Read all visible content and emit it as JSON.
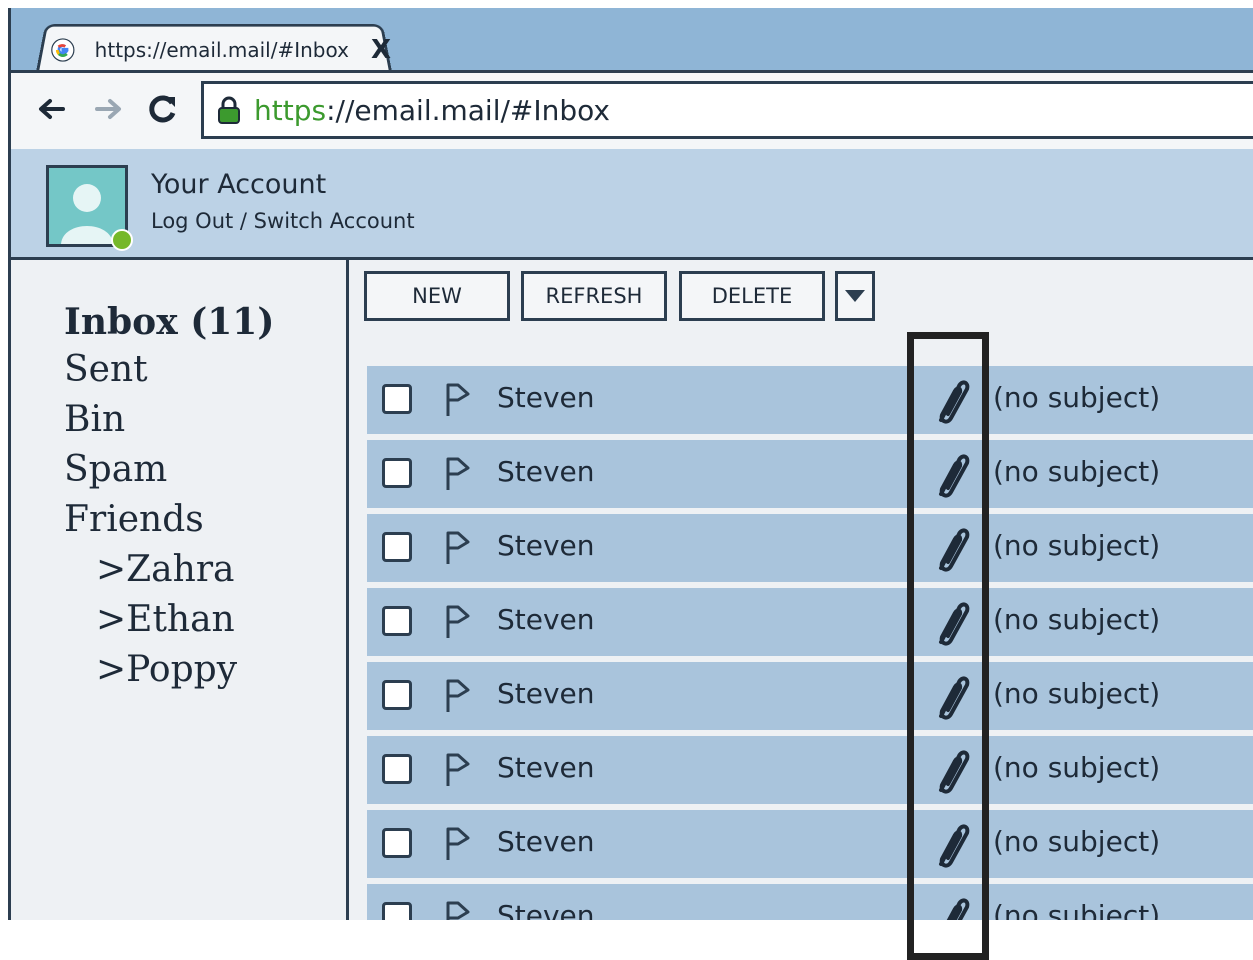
{
  "tab": {
    "title": "https://email.mail/#Inbox",
    "close_glyph": "X",
    "icon": "google-g-icon"
  },
  "address_bar": {
    "protocol": "https",
    "rest": "://email.mail/#Inbox"
  },
  "account": {
    "name": "Your Account",
    "links": "Log Out / Switch Account",
    "status_color": "#76b82a"
  },
  "folders": {
    "inbox": "Inbox (11)",
    "sent": "Sent",
    "bin": "Bin",
    "spam": "Spam",
    "friends": "Friends",
    "zahra": ">Zahra",
    "ethan": ">Ethan",
    "poppy": ">Poppy"
  },
  "actions": {
    "new": "NEW",
    "refresh": "REFRESH",
    "delete": "DELETE",
    "more_icon": "dropdown-triangle-icon"
  },
  "emails": [
    {
      "sender": "Steven",
      "subject": "(no subject)",
      "has_attachment": true
    },
    {
      "sender": "Steven",
      "subject": "(no subject)",
      "has_attachment": true
    },
    {
      "sender": "Steven",
      "subject": "(no subject)",
      "has_attachment": true
    },
    {
      "sender": "Steven",
      "subject": "(no subject)",
      "has_attachment": true
    },
    {
      "sender": "Steven",
      "subject": "(no subject)",
      "has_attachment": true
    },
    {
      "sender": "Steven",
      "subject": "(no subject)",
      "has_attachment": true
    },
    {
      "sender": "Steven",
      "subject": "(no subject)",
      "has_attachment": true
    },
    {
      "sender": "Steven",
      "subject": "(no subject)",
      "has_attachment": true
    }
  ],
  "colors": {
    "row_bg": "#a9c4dc",
    "highlight_border": "#222222",
    "url_protocol": "#3c9a2e"
  }
}
